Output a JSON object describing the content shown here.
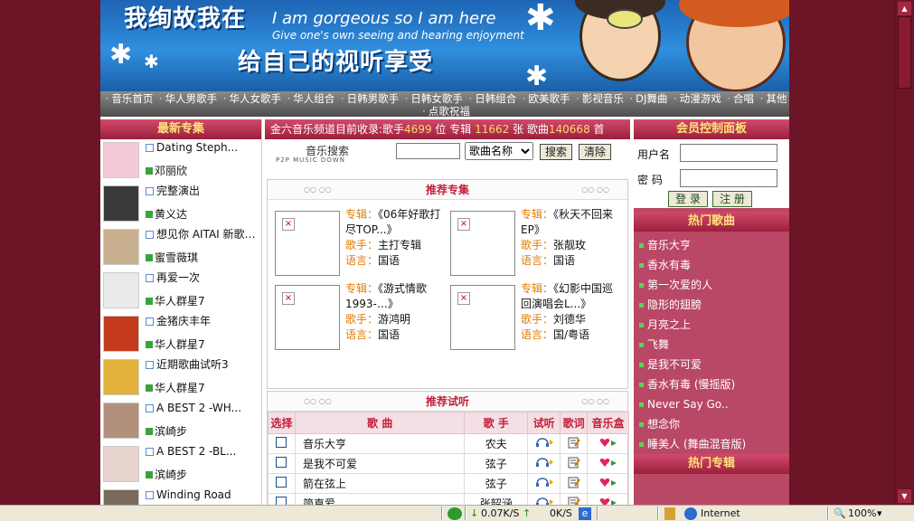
{
  "banner": {
    "title_cn": "我绚故我在",
    "slogan_en": "I am gorgeous so I am here",
    "subslogan_en": "Give one's own seeing and hearing enjoyment",
    "tagline_cn": "给自己的视听享受"
  },
  "nav": {
    "items": [
      "音乐首页",
      "华人男歌手",
      "华人女歌手",
      "华人组合",
      "日韩男歌手",
      "日韩女歌手",
      "日韩组合",
      "欧美歌手",
      "影视音乐",
      "DJ舞曲",
      "动漫游戏",
      "合唱",
      "其他",
      "点歌祝福"
    ]
  },
  "left": {
    "title": "最新专集",
    "albums": [
      {
        "name": "Dating Steph...",
        "singer": "邓丽欣"
      },
      {
        "name": "完整演出",
        "singer": "黄义达"
      },
      {
        "name": "想见你 AITAI 新歌…",
        "singer": "蜜雪薇琪"
      },
      {
        "name": "再爱一次",
        "singer": "华人群星7"
      },
      {
        "name": "金猪庆丰年",
        "singer": "华人群星7"
      },
      {
        "name": "近期歌曲试听3",
        "singer": "华人群星7"
      },
      {
        "name": "A BEST 2 -WH...",
        "singer": "滨崎步"
      },
      {
        "name": "A BEST 2 -BL...",
        "singer": "滨崎步"
      },
      {
        "name": "Winding Road",
        "singer": ""
      }
    ]
  },
  "stats": {
    "prefix": "金六音乐频道目前收录:歌手",
    "singers": "4699",
    "singer_unit": " 位 专辑",
    "albums": "11662",
    "album_unit": " 张 歌曲",
    "songs": "140668",
    "song_unit": " 首"
  },
  "search": {
    "label": "音乐搜索",
    "sublabel": "P2P MUSIC DOWN",
    "input_value": "",
    "select_value": "歌曲名称",
    "search_btn": "搜索",
    "clear_btn": "清除"
  },
  "recommend": {
    "title": "推荐专集",
    "k_album": "专辑：",
    "k_singer": "歌手：",
    "k_lang": "语言：",
    "items": [
      {
        "album": "《06年好歌打尽TOP...》",
        "singer": "主打专辑",
        "lang": "国语"
      },
      {
        "album": "《秋天不回来EP》",
        "singer": "张靓玫",
        "lang": "国语"
      },
      {
        "album": "《游式情歌1993-…》",
        "singer": "游鸿明",
        "lang": "国语"
      },
      {
        "album": "《幻影中国巡回演唱会L...》",
        "singer": "刘德华",
        "lang": "国/粤语"
      }
    ]
  },
  "trial": {
    "title": "推荐试听",
    "headers": [
      "选择",
      "歌 曲",
      "歌 手",
      "试听",
      "歌词",
      "音乐盒"
    ],
    "rows": [
      {
        "song": "音乐大亨",
        "singer": "农夫"
      },
      {
        "song": "是我不可爱",
        "singer": "弦子"
      },
      {
        "song": "箭在弦上",
        "singer": "弦子"
      },
      {
        "song": "简直爱",
        "singer": "张韶涵"
      }
    ]
  },
  "member": {
    "title": "会员控制面板",
    "user_label": "用户名",
    "pass_label": "密 码",
    "login_btn": "登 录",
    "register_btn": "注 册"
  },
  "hot": {
    "title": "热门歌曲",
    "songs": [
      "音乐大亨",
      "香水有毒",
      "第一次爱的人",
      "隐形的翅膀",
      "月亮之上",
      "飞舞",
      "是我不可爱",
      "香水有毒 (慢摇版)",
      "Never Say Go..",
      "想念你",
      "睡美人 (舞曲混音版)"
    ]
  },
  "hot_album": {
    "title": "热门专辑"
  },
  "statusbar": {
    "down_speed": "0.07K/S",
    "up_speed": "0K/S",
    "zone": "Internet",
    "zoom": "100%"
  },
  "colors": {
    "brand": "#9c1f3c",
    "accent": "#c41e3a",
    "number": "#e07b00"
  }
}
